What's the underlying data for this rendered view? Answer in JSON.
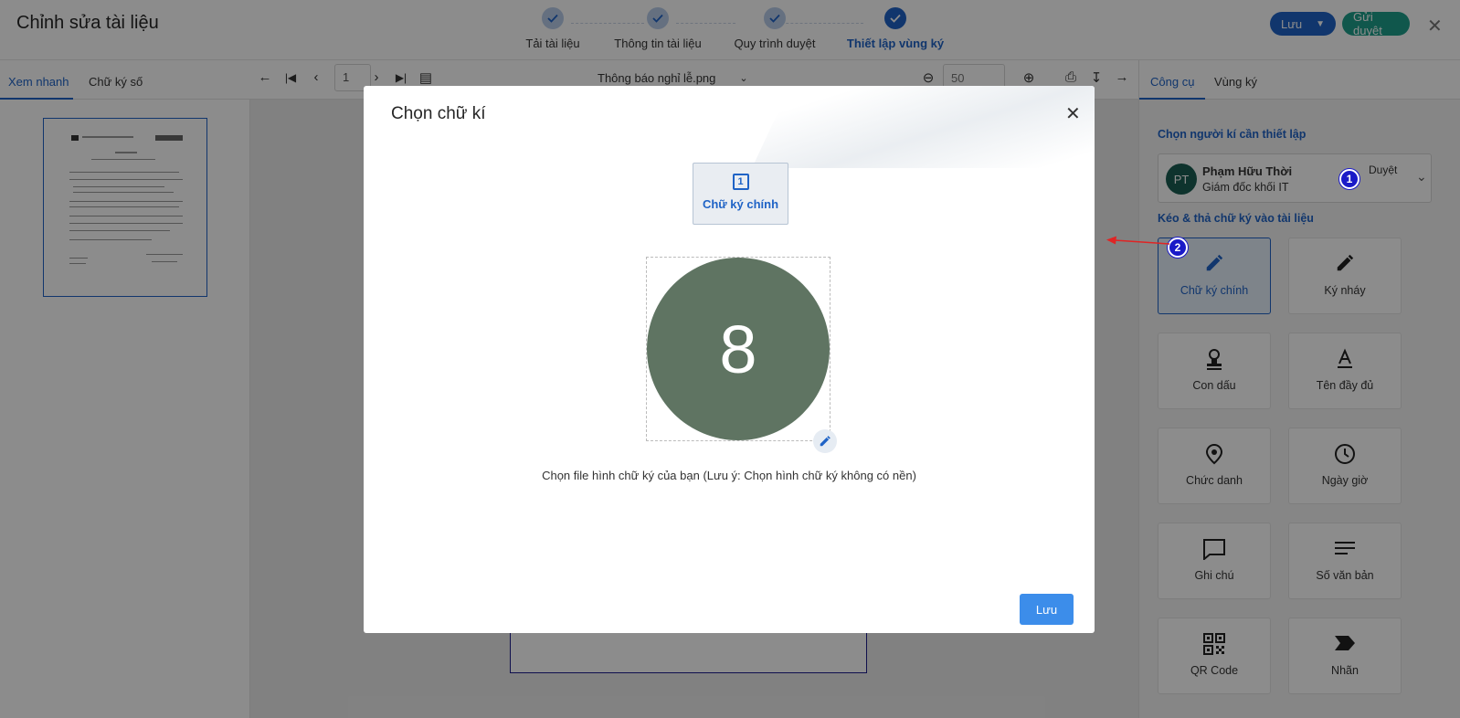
{
  "header": {
    "title": "Chỉnh sửa tài liệu",
    "steps": [
      {
        "label": "Tải tài liệu"
      },
      {
        "label": "Thông tin tài liệu"
      },
      {
        "label": "Quy trình duyệt"
      },
      {
        "label": "Thiết lập vùng ký"
      }
    ],
    "save_label": "Lưu",
    "send_label": "Gửi duyệt",
    "close_icon": "close-icon"
  },
  "left_panel": {
    "tabs": [
      {
        "label": "Xem nhanh"
      },
      {
        "label": "Chữ ký số"
      }
    ]
  },
  "toolbar": {
    "page": "1",
    "file_name": "Thông báo nghỉ lễ.png",
    "zoom": "50"
  },
  "right_panel": {
    "tabs": [
      {
        "label": "Công cụ"
      },
      {
        "label": "Vùng ký"
      }
    ],
    "signer_section_title": "Chọn người kí cần thiết lập",
    "signer": {
      "initials": "PT",
      "name": "Phạm Hữu Thời",
      "role": "Giám đốc khối IT",
      "status": "Duyệt"
    },
    "drag_section_title": "Kéo & thả chữ ký vào tài liệu",
    "tools": [
      {
        "label": "Chữ ký chính",
        "icon": "pen-icon"
      },
      {
        "label": "Ký nháy",
        "icon": "pen-icon"
      },
      {
        "label": "Con dấu",
        "icon": "stamp-icon"
      },
      {
        "label": "Tên đầy đủ",
        "icon": "text-icon"
      },
      {
        "label": "Chức danh",
        "icon": "location-pin-icon"
      },
      {
        "label": "Ngày giờ",
        "icon": "clock-icon"
      },
      {
        "label": "Ghi chú",
        "icon": "comment-icon"
      },
      {
        "label": "Số văn bản",
        "icon": "lines-icon"
      },
      {
        "label": "QR Code",
        "icon": "qr-code-icon"
      },
      {
        "label": "Nhãn",
        "icon": "label-icon"
      }
    ],
    "badges": [
      "1",
      "2"
    ]
  },
  "modal": {
    "title": "Chọn chữ kí",
    "sig_tab_number": "1",
    "sig_tab_label": "Chữ ký chính",
    "signature_preview_text": "8",
    "hint": "Chọn file hình chữ ký của bạn (Lưu ý: Chọn hình chữ ký không có nền)",
    "save_label": "Lưu"
  },
  "colors": {
    "primary": "#1f63c6",
    "teal": "#1e9e8a",
    "signature_bg": "#5f7462",
    "annotation_arrow": "#e02424",
    "badge": "#1a1ac8"
  }
}
